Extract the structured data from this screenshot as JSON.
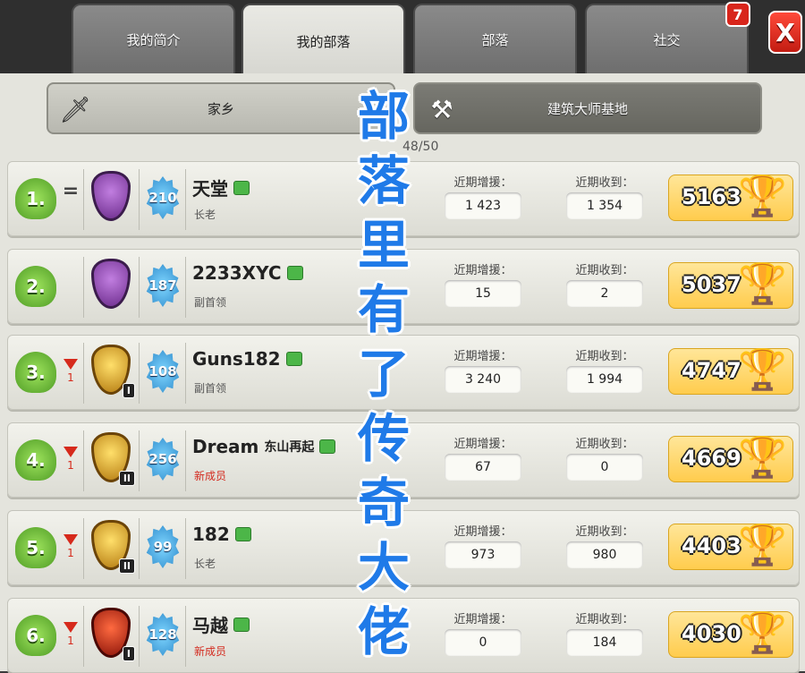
{
  "tabs": [
    {
      "label": "我的简介"
    },
    {
      "label": "我的部落"
    },
    {
      "label": "部落"
    },
    {
      "label": "社交"
    }
  ],
  "notification_count": "7",
  "close_label": "X",
  "subtabs": {
    "home": {
      "label": "家乡",
      "icon": "sword-icon"
    },
    "builder": {
      "label": "建筑大师基地",
      "icon": "crossed-axes-icon"
    }
  },
  "members_count": "48/50",
  "stat_labels": {
    "donated": "近期增援：",
    "received": "近期收到："
  },
  "members": [
    {
      "rank": "1.",
      "change": "=",
      "league": "legend",
      "tier": "",
      "level": "210",
      "name": "天堂",
      "name_suffix": "",
      "role": "长老",
      "role_new": false,
      "donated": "1 423",
      "received": "1 354",
      "trophies": "5163"
    },
    {
      "rank": "2.",
      "change": "",
      "league": "legend",
      "tier": "",
      "level": "187",
      "name": "2233XYC",
      "name_suffix": "",
      "role": "副首领",
      "role_new": false,
      "donated": "15",
      "received": "2",
      "trophies": "5037"
    },
    {
      "rank": "3.",
      "change": "1",
      "league": "titan",
      "tier": "I",
      "level": "108",
      "name": "Guns182",
      "name_suffix": "",
      "role": "副首领",
      "role_new": false,
      "donated": "3 240",
      "received": "1 994",
      "trophies": "4747"
    },
    {
      "rank": "4.",
      "change": "1",
      "league": "titan",
      "tier": "II",
      "level": "256",
      "name": "Dream",
      "name_suffix": "东山再起",
      "role": "新成员",
      "role_new": true,
      "donated": "67",
      "received": "0",
      "trophies": "4669"
    },
    {
      "rank": "5.",
      "change": "1",
      "league": "titan",
      "tier": "II",
      "level": "99",
      "name": "182",
      "name_suffix": "",
      "role": "长老",
      "role_new": false,
      "donated": "973",
      "received": "980",
      "trophies": "4403"
    },
    {
      "rank": "6.",
      "change": "1",
      "league": "champion",
      "tier": "I",
      "level": "128",
      "name": "马越",
      "name_suffix": "",
      "role": "新成员",
      "role_new": true,
      "donated": "0",
      "received": "184",
      "trophies": "4030"
    }
  ],
  "overlay_text": [
    "部",
    "落",
    "里",
    "有",
    "了",
    "传",
    "奇",
    "大",
    "佬"
  ],
  "colors": {
    "overlay": "#1f7ae8",
    "demotion": "#d62a1c",
    "new_member": "#d32a1e",
    "trophy_bg": "#ffcc4d"
  }
}
